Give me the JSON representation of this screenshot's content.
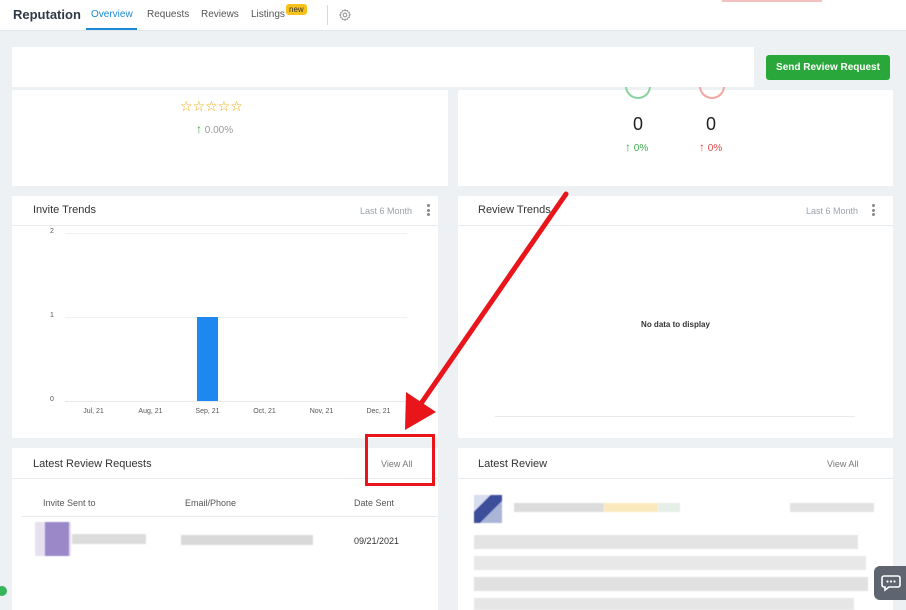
{
  "header": {
    "title": "Reputation",
    "tabs": [
      {
        "label": "Overview"
      },
      {
        "label": "Requests"
      },
      {
        "label": "Reviews"
      },
      {
        "label": "Listings"
      }
    ],
    "new_badge": "new"
  },
  "actions": {
    "send_review_request": "Send Review Request"
  },
  "rating_card": {
    "stars": "☆☆☆☆☆",
    "change_arrow": "↑",
    "change": "0.00%"
  },
  "sentiment_card": {
    "positive": {
      "count": "0",
      "arrow": "↑",
      "change": "0%"
    },
    "negative": {
      "count": "0",
      "arrow": "↑",
      "change": "0%"
    }
  },
  "invite_trends": {
    "title": "Invite Trends",
    "range": "Last 6 Month"
  },
  "review_trends": {
    "title": "Review Trends",
    "range": "Last 6 Month",
    "empty": "No data to display"
  },
  "chart_data": {
    "type": "bar",
    "categories": [
      "Jul, 21",
      "Aug, 21",
      "Sep, 21",
      "Oct, 21",
      "Nov, 21",
      "Dec, 21"
    ],
    "values": [
      0,
      0,
      1,
      0,
      0,
      0
    ],
    "yticks": [
      "0",
      "1",
      "2"
    ],
    "ylim": [
      0,
      2
    ],
    "color": "#1e88f0",
    "grid": true
  },
  "latest_requests": {
    "title": "Latest Review Requests",
    "view_all": "View All",
    "columns": [
      "Invite Sent to",
      "Email/Phone",
      "Date Sent"
    ],
    "rows": [
      {
        "date": "09/21/2021"
      }
    ]
  },
  "latest_review": {
    "title": "Latest Review",
    "view_all": "View All"
  },
  "colors": {
    "accent": "#1a8ad6",
    "primary_button": "#2aa73a",
    "annotation": "#e8151b"
  }
}
